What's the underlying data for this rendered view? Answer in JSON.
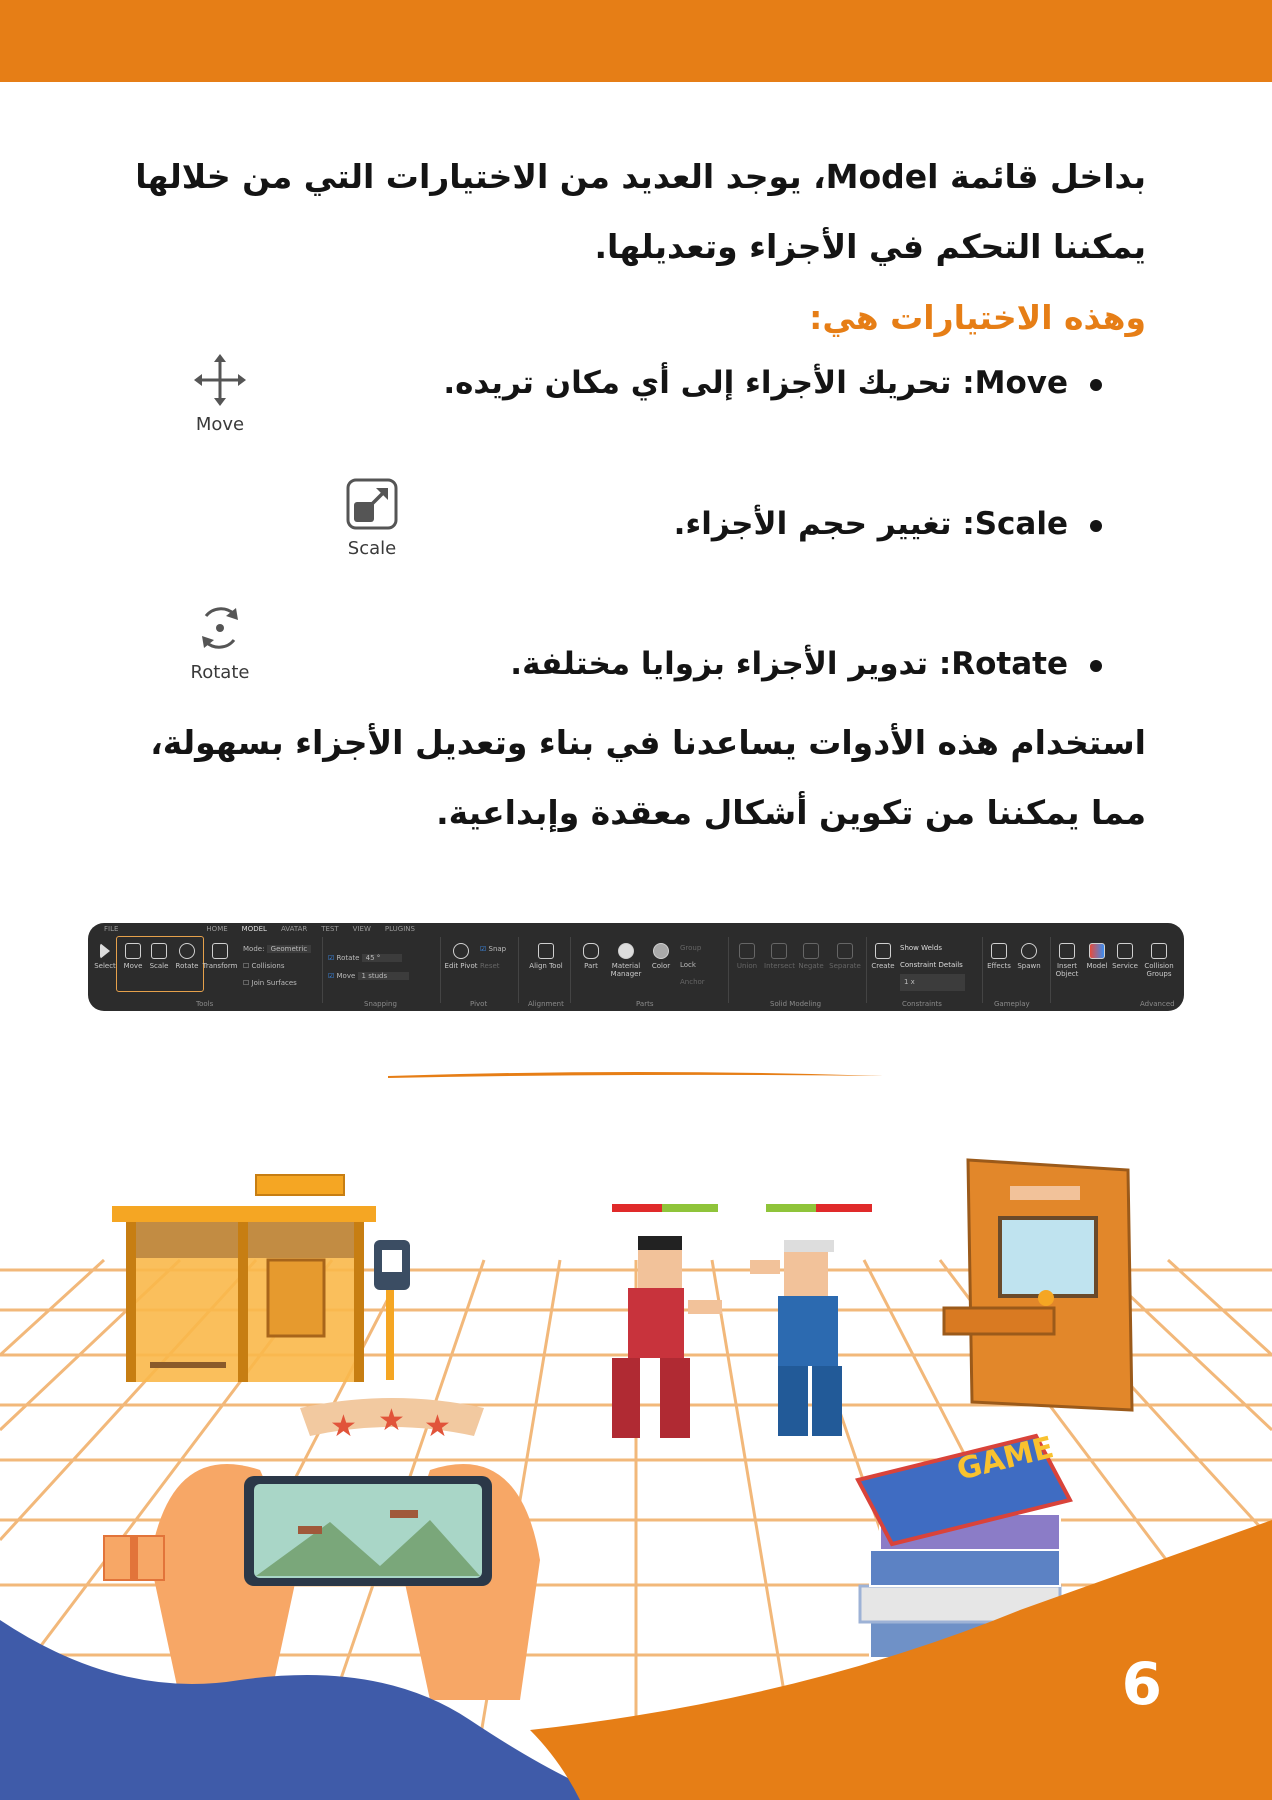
{
  "intro_paragraph": "بداخل قائمة Model، يوجد العديد من الاختيارات التي من خلالها يمكننا التحكم في الأجزاء وتعديلها.",
  "options_heading": "وهذه الاختيارات هي:",
  "options": [
    {
      "text": "Move: تحريك الأجزاء إلى أي مكان تريده.",
      "icon_label": "Move",
      "icon": "move-arrows-icon"
    },
    {
      "text": "Scale: تغيير حجم الأجزاء.",
      "icon_label": "Scale",
      "icon": "scale-icon"
    },
    {
      "text": "Rotate: تدوير الأجزاء بزوايا مختلفة.",
      "icon_label": "Rotate",
      "icon": "rotate-icon"
    }
  ],
  "summary_paragraph": "استخدام هذه الأدوات يساعدنا في بناء وتعديل الأجزاء بسهولة، مما يمكننا من تكوين أشكال معقدة وإبداعية.",
  "ribbon": {
    "tabs": [
      "FILE",
      "HOME",
      "MODEL",
      "AVATAR",
      "TEST",
      "VIEW",
      "PLUGINS"
    ],
    "tools": [
      "Select",
      "Move",
      "Scale",
      "Rotate",
      "Transform"
    ],
    "mode_label": "Mode:",
    "mode_value": "Geometric",
    "collisions": "Collisions",
    "join_surfaces": "Join Surfaces",
    "rotate_label": "Rotate",
    "rotate_value": "45 °",
    "move_label": "Move",
    "move_value": "1 studs",
    "snap": "Snap",
    "reset": "Reset",
    "edit_pivot": "Edit Pivot",
    "align_tool": "Align Tool",
    "part": "Part",
    "material_manager": "Material Manager",
    "color": "Color",
    "group": "Group",
    "lock": "Lock",
    "anchor": "Anchor",
    "solid": [
      "Union",
      "Intersect",
      "Negate",
      "Separate"
    ],
    "create": "Create",
    "show_welds": "Show Welds",
    "constraint_details": "Constraint Details",
    "scale_value": "1 x",
    "gameplay": [
      "Effects",
      "Spawn"
    ],
    "advanced": [
      "Insert Object",
      "Model",
      "Service",
      "Collision Groups"
    ],
    "groups": [
      "Tools",
      "Snapping",
      "Pivot",
      "Alignment",
      "Parts",
      "Solid Modeling",
      "Constraints",
      "Gameplay",
      "Advanced"
    ]
  },
  "illustration_game_word": "GAME",
  "page_number": "6",
  "colors": {
    "accent": "#e67e16",
    "blue": "#3f5ba9",
    "text": "#141414"
  }
}
